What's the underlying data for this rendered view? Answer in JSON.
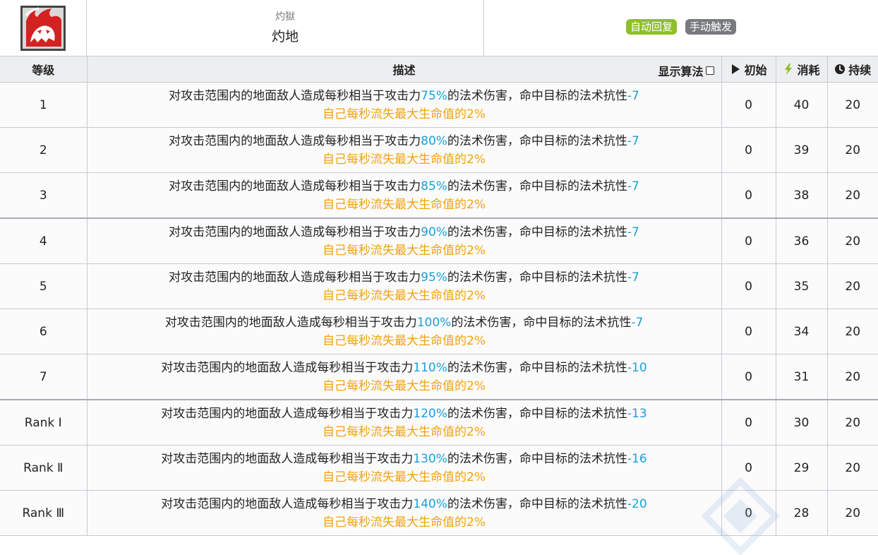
{
  "skill": {
    "icon": "flame-beast-icon",
    "subtitle": "灼獄",
    "name": "灼地",
    "tags": [
      {
        "label": "自动回复",
        "color": "#8fbf2b"
      },
      {
        "label": "手动触发",
        "color": "#777a7e"
      }
    ]
  },
  "table": {
    "headers": {
      "level": "等级",
      "description": "描述",
      "show_formula": "显示算法",
      "initial": "初始",
      "cost": "消耗",
      "duration": "持续"
    },
    "text": {
      "desc_prefix": "对攻击范围内的地面敌人造成每秒相当于攻击力",
      "desc_middle": "的法术伤害，命中目标的法术抗性",
      "desc_line2": "自己每秒流失最大生命值的2%"
    },
    "rows": [
      {
        "level": "1",
        "atk": "75%",
        "res": "-7",
        "initial": "0",
        "cost": "40",
        "duration": "20"
      },
      {
        "level": "2",
        "atk": "80%",
        "res": "-7",
        "initial": "0",
        "cost": "39",
        "duration": "20"
      },
      {
        "level": "3",
        "atk": "85%",
        "res": "-7",
        "initial": "0",
        "cost": "38",
        "duration": "20"
      },
      {
        "level": "4",
        "atk": "90%",
        "res": "-7",
        "initial": "0",
        "cost": "36",
        "duration": "20"
      },
      {
        "level": "5",
        "atk": "95%",
        "res": "-7",
        "initial": "0",
        "cost": "35",
        "duration": "20"
      },
      {
        "level": "6",
        "atk": "100%",
        "res": "-7",
        "initial": "0",
        "cost": "34",
        "duration": "20"
      },
      {
        "level": "7",
        "atk": "110%",
        "res": "-10",
        "initial": "0",
        "cost": "31",
        "duration": "20"
      },
      {
        "level": "Rank Ⅰ",
        "atk": "120%",
        "res": "-13",
        "initial": "0",
        "cost": "30",
        "duration": "20"
      },
      {
        "level": "Rank Ⅱ",
        "atk": "130%",
        "res": "-16",
        "initial": "0",
        "cost": "29",
        "duration": "20"
      },
      {
        "level": "Rank Ⅲ",
        "atk": "140%",
        "res": "-20",
        "initial": "0",
        "cost": "28",
        "duration": "20"
      }
    ]
  },
  "colors": {
    "highlight_blue": "#1ba0d7",
    "note_orange": "#f2a20b",
    "header_bg": "#edeef0"
  }
}
